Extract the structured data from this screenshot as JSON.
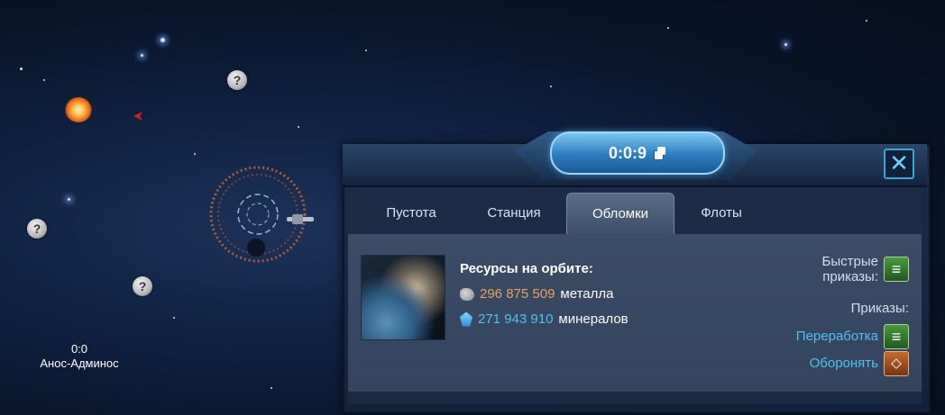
{
  "map": {
    "coords": "0:0",
    "location_name": "Анос-Админос",
    "markers": [
      {
        "icon": "question-mark-icon",
        "glyph": "?"
      },
      {
        "icon": "question-mark-icon",
        "glyph": "?"
      },
      {
        "icon": "question-mark-icon",
        "glyph": "?"
      }
    ]
  },
  "panel": {
    "timer": "0:0:9",
    "close_glyph": "✕",
    "tabs": [
      {
        "label": "Пустота",
        "active": false
      },
      {
        "label": "Станция",
        "active": false
      },
      {
        "label": "Обломки",
        "active": true
      },
      {
        "label": "Флоты",
        "active": false
      }
    ],
    "resources": {
      "title": "Ресурсы на орбите:",
      "metal": {
        "amount": "296 875 509",
        "unit": "металла",
        "color": "#e8a060",
        "icon": "metal-ore-icon"
      },
      "minerals": {
        "amount": "271 943 910",
        "unit": "минералов",
        "color": "#4fc1ef",
        "icon": "mineral-crystal-icon"
      }
    },
    "quick_orders_label": "Быстрые приказы:",
    "orders_label": "Приказы:",
    "orders": [
      {
        "label": "Переработка",
        "icon": "recycle-icon"
      },
      {
        "label": "Оборонять",
        "icon": "defend-shield-icon"
      }
    ]
  },
  "colors": {
    "accent": "#4fc1ef",
    "metal": "#e8a060"
  }
}
